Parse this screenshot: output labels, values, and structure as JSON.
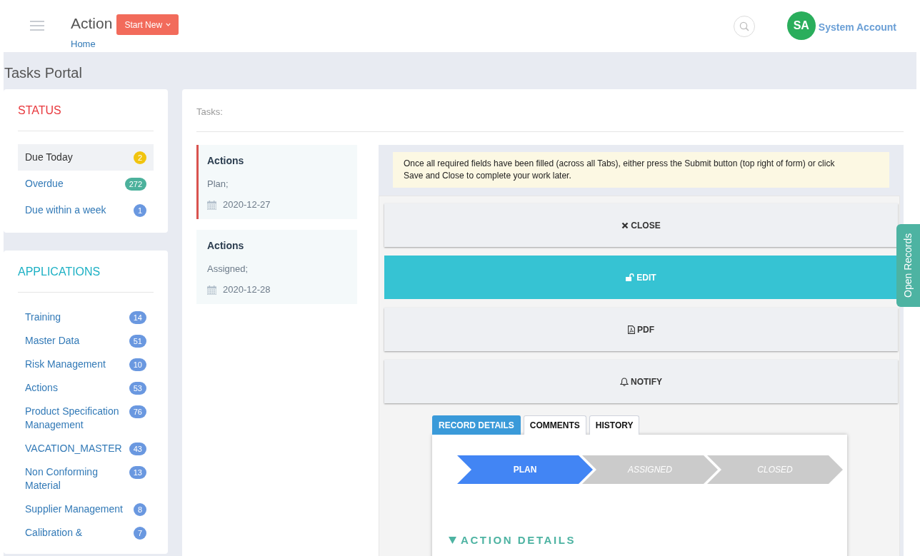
{
  "header": {
    "title": "Action",
    "start_button": "Start New",
    "breadcrumb": "Home",
    "user": {
      "initials": "SA",
      "name": "System Account"
    }
  },
  "page_title": "Tasks Portal",
  "status": {
    "title": "STATUS",
    "items": [
      {
        "label": "Due Today",
        "count": "2",
        "color": "#f1c40f",
        "selected": true
      },
      {
        "label": "Overdue",
        "count": "272",
        "color": "#4cb19c",
        "selected": false
      },
      {
        "label": "Due within a week",
        "count": "1",
        "color": "#6a98e0",
        "selected": false
      }
    ]
  },
  "applications": {
    "title": "APPLICATIONS",
    "items": [
      {
        "label": "Training",
        "count": "14"
      },
      {
        "label": "Master Data",
        "count": "51"
      },
      {
        "label": "Risk Management",
        "count": "10"
      },
      {
        "label": "Actions",
        "count": "53"
      },
      {
        "label": "Product Specification Management",
        "count": "76"
      },
      {
        "label": "VACATION_MASTER",
        "count": "43"
      },
      {
        "label": "Non Conforming Material",
        "count": "13"
      },
      {
        "label": "Supplier Management",
        "count": "8"
      },
      {
        "label": "Calibration &",
        "count": "7"
      }
    ]
  },
  "tasks": {
    "label": "Tasks:",
    "items": [
      {
        "title": "Actions",
        "state": "Plan;",
        "date": "2020-12-27",
        "selected": true
      },
      {
        "title": "Actions",
        "state": "Assigned;",
        "date": "2020-12-28",
        "selected": false
      }
    ]
  },
  "notice": "Once all required fields have been filled (across all Tabs), either press the Submit button (top right of form) or click Save and Close to complete your work later.",
  "actions": [
    {
      "kind": "close",
      "label": "CLOSE"
    },
    {
      "kind": "edit",
      "label": "EDIT"
    },
    {
      "kind": "pdf",
      "label": "PDF"
    },
    {
      "kind": "notify",
      "label": "NOTIFY"
    }
  ],
  "tabs": [
    {
      "label": "RECORD DETAILS",
      "selected": true
    },
    {
      "label": "COMMENTS",
      "selected": false
    },
    {
      "label": "HISTORY",
      "selected": false
    }
  ],
  "stages": [
    {
      "label": "PLAN",
      "selected": true
    },
    {
      "label": "ASSIGNED",
      "selected": false
    },
    {
      "label": "CLOSED",
      "selected": false
    }
  ],
  "section": {
    "title": "ACTION DETAILS",
    "expanded": true
  },
  "side_tab": "Open Records"
}
